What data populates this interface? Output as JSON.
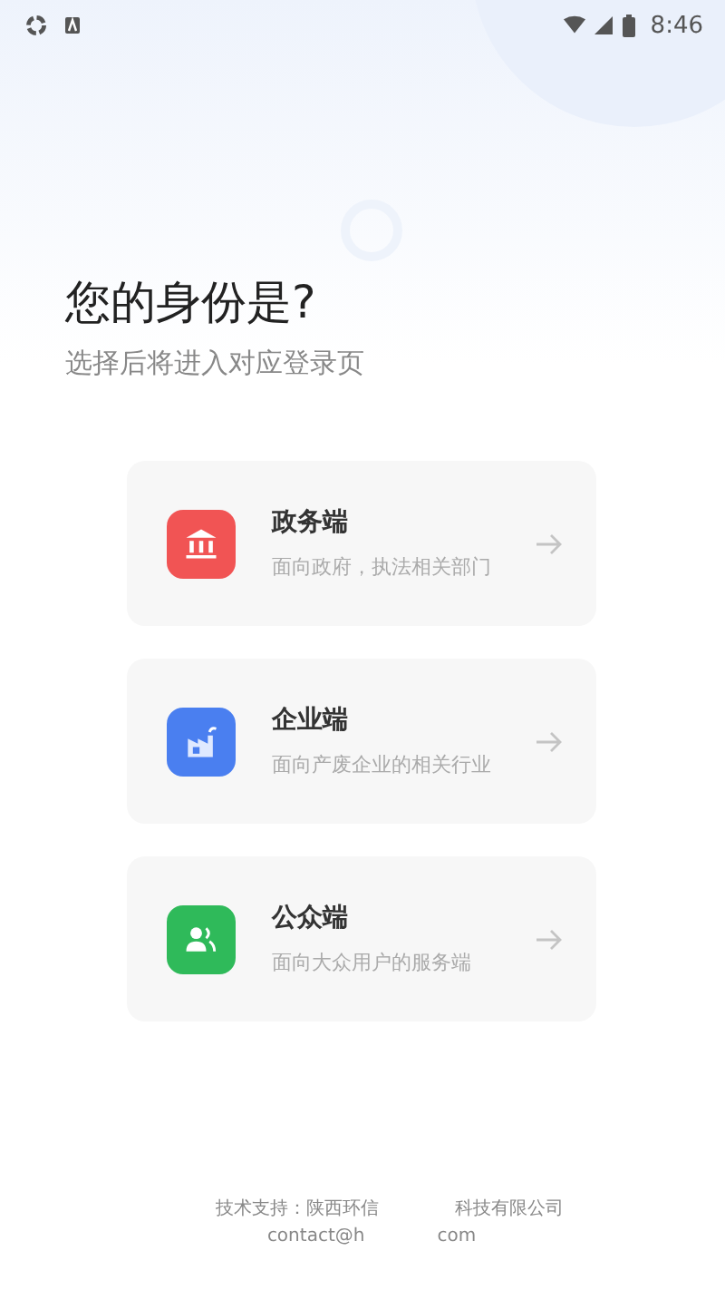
{
  "status_bar": {
    "time": "8:46"
  },
  "heading": {
    "title": "您的身份是?",
    "subtitle": "选择后将进入对应登录页"
  },
  "options": [
    {
      "kind": "government",
      "title": "政务端",
      "description": "面向政府，执法相关部门"
    },
    {
      "kind": "enterprise",
      "title": "企业端",
      "description": "面向产废企业的相关行业"
    },
    {
      "kind": "public",
      "title": "公众端",
      "description": "面向大众用户的服务端"
    }
  ],
  "footer": {
    "line_1": [
      "技术支持：陕西环信",
      "科技有限公司"
    ],
    "line_2": [
      "contact@h",
      "com"
    ]
  }
}
